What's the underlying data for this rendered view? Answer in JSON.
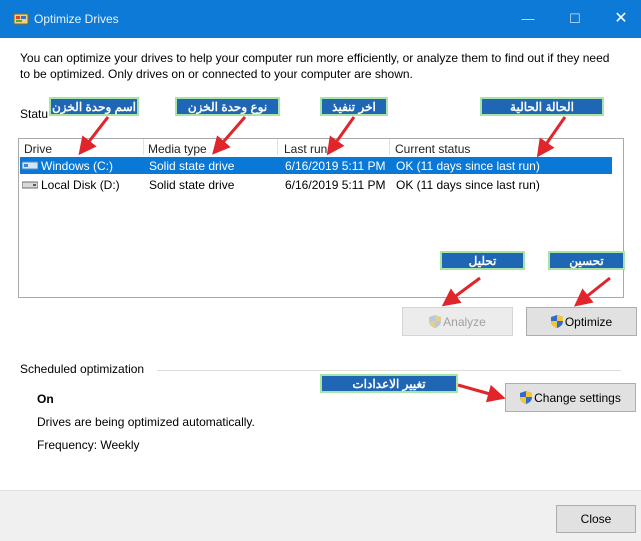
{
  "window": {
    "title": "Optimize Drives",
    "min_glyph": "—",
    "max_glyph": "☐",
    "close_glyph": "✕"
  },
  "description": "You can optimize your drives to help your computer run more efficiently, or analyze them to find out if they need to be optimized. Only drives on or connected to your computer are shown.",
  "status_label": "Statu",
  "list": {
    "columns": [
      "Drive",
      "Media type",
      "Last run",
      "Current status"
    ],
    "rows": [
      {
        "drive": "Windows (C:)",
        "media": "Solid state drive",
        "last_run": "6/16/2019 5:11 PM",
        "status": "OK (11 days since last run)",
        "selected": true
      },
      {
        "drive": "Local Disk (D:)",
        "media": "Solid state drive",
        "last_run": "6/16/2019 5:11 PM",
        "status": "OK (11 days since last run)",
        "selected": false
      }
    ]
  },
  "buttons": {
    "analyze": "Analyze",
    "optimize": "Optimize",
    "change_settings": "Change settings",
    "close": "Close"
  },
  "scheduled": {
    "label": "Scheduled optimization",
    "state": "On",
    "description": "Drives are being optimized automatically.",
    "frequency": "Frequency: Weekly"
  },
  "annotations": {
    "drive_name": "اسم وحدة الخزن",
    "media_type": "نوع وحدة الخزن",
    "last_run": "اخر تنفيذ",
    "current_status": "الحالة الحالية",
    "analyze": "تحليل",
    "optimize": "تحسين",
    "change_settings": "تغيير الاعدادات"
  },
  "colors": {
    "titlebar": "#0c7ad6",
    "selection": "#0a78d7",
    "callout_fill": "#1f66b4",
    "callout_border": "#a8e4a4",
    "arrow": "#e0262a"
  },
  "icons": [
    "app-defrag-icon",
    "ssd-drive-icon",
    "uac-shield-icon"
  ]
}
